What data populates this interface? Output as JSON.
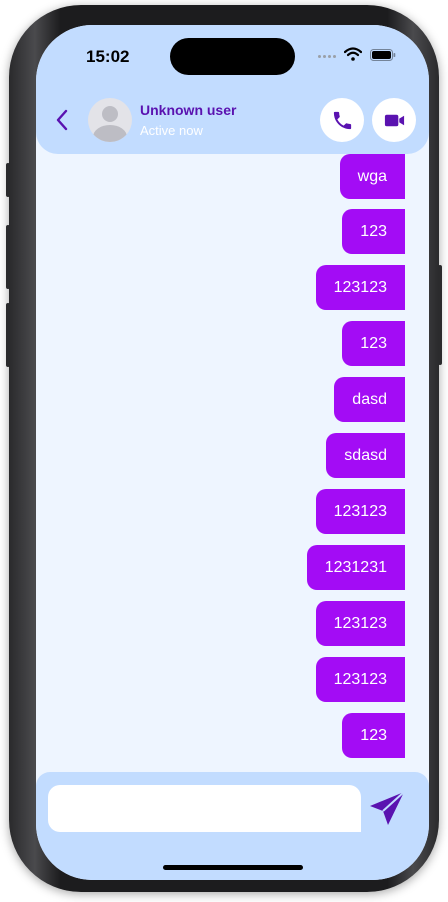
{
  "status_bar": {
    "time": "15:02"
  },
  "header": {
    "user_name": "Unknown user",
    "user_status": "Active now"
  },
  "messages": [
    {
      "text": "wga"
    },
    {
      "text": "123"
    },
    {
      "text": "123123"
    },
    {
      "text": "123"
    },
    {
      "text": "dasd"
    },
    {
      "text": "sdasd"
    },
    {
      "text": "123123"
    },
    {
      "text": "1231231"
    },
    {
      "text": "123123"
    },
    {
      "text": "123123"
    },
    {
      "text": "123"
    }
  ],
  "composer": {
    "value": "",
    "placeholder": ""
  },
  "colors": {
    "header_bg": "#c2dcff",
    "chat_bg": "#eef5ff",
    "bubble": "#a30cf5",
    "accent": "#5a12b0"
  }
}
